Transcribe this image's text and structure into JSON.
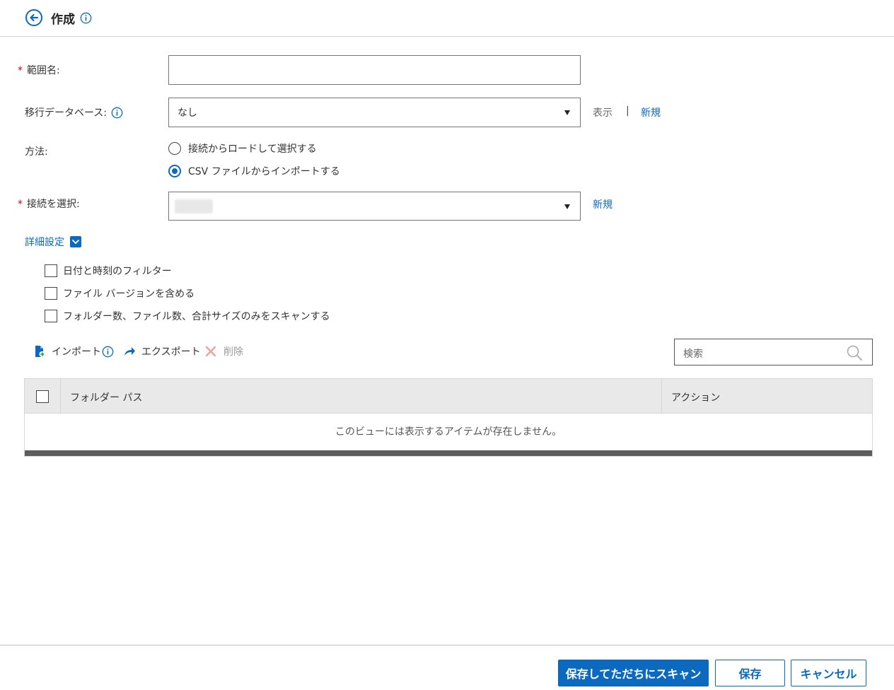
{
  "header": {
    "title": "作成"
  },
  "form": {
    "scope_name": {
      "label": "範囲名:",
      "required_mark": "*",
      "value": ""
    },
    "migration_db": {
      "label": "移行データベース:",
      "selected": "なし",
      "view_link": "表示",
      "separator": "|",
      "new_link": "新規"
    },
    "method": {
      "label": "方法:",
      "options": [
        {
          "label": "接続からロードして選択する",
          "checked": false
        },
        {
          "label": "CSV ファイルからインポートする",
          "checked": true
        }
      ]
    },
    "connection": {
      "label": "接続を選択:",
      "required_mark": "*",
      "selected": "",
      "new_link": "新規"
    }
  },
  "advanced": {
    "label": "詳細設定",
    "options": [
      {
        "label": "日付と時刻のフィルター",
        "checked": false
      },
      {
        "label": "ファイル バージョンを含める",
        "checked": false
      },
      {
        "label": "フォルダー数、ファイル数、合計サイズのみをスキャンする",
        "checked": false
      }
    ]
  },
  "toolbar": {
    "import_label": "インポート",
    "export_label": "エクスポート",
    "delete_label": "削除",
    "search_placeholder": "検索"
  },
  "grid": {
    "columns": [
      "フォルダー パス",
      "アクション"
    ],
    "empty_message": "このビューには表示するアイテムが存在しません。",
    "rows": []
  },
  "footer": {
    "save_scan_label": "保存してただちにスキャン",
    "save_label": "保存",
    "cancel_label": "キャンセル"
  },
  "colors": {
    "accent": "#0b6abf",
    "required": "#d0021b"
  }
}
